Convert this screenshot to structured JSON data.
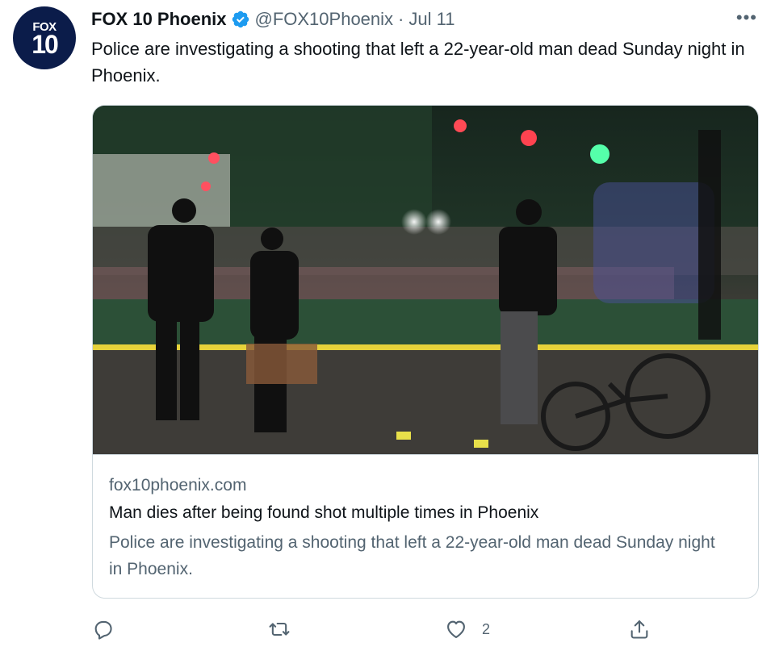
{
  "account": {
    "avatar": {
      "line1": "FOX",
      "line2": "10"
    },
    "name": "FOX 10 Phoenix",
    "handle": "@FOX10Phoenix",
    "separator": "·",
    "date": "Jul 11"
  },
  "more_label": "•••",
  "tweet": {
    "text": "Police are investigating a shooting that left a 22-year-old man dead Sunday night in Phoenix."
  },
  "link_card": {
    "image_icon": "news-photo-police-scene",
    "domain": "fox10phoenix.com",
    "title": "Man dies after being found shot multiple times in Phoenix",
    "description": "Police are investigating a shooting that left a 22-year-old man dead Sunday night in Phoenix."
  },
  "actions": {
    "reply": {
      "icon": "reply-icon"
    },
    "retweet": {
      "icon": "retweet-icon"
    },
    "like": {
      "icon": "heart-icon",
      "count": "2"
    },
    "share": {
      "icon": "share-icon"
    }
  },
  "colors": {
    "text_primary": "#0f1419",
    "text_secondary": "#536471",
    "verified_blue": "#1d9bf0",
    "border": "#cfd9de",
    "avatar_bg": "#0b1c4a"
  }
}
